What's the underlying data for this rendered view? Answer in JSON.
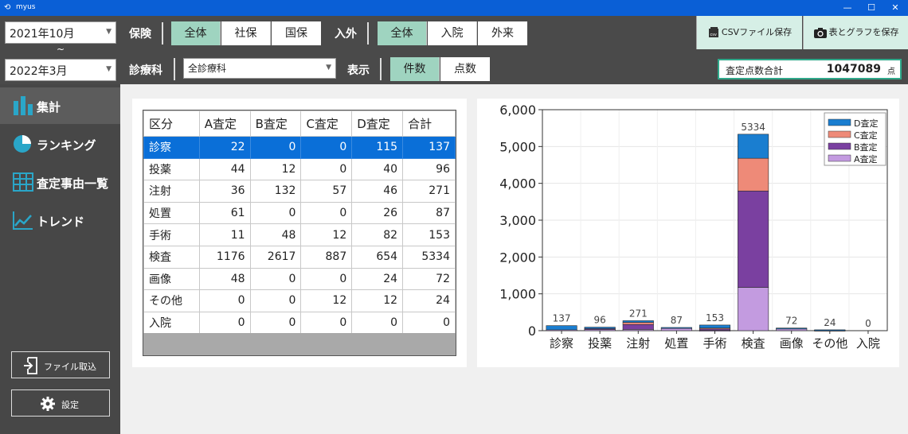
{
  "window": {
    "title": "myus",
    "minimize": "—",
    "maximize": "☐",
    "close": "✕"
  },
  "toolbar": {
    "period_from": "2021年10月",
    "period_tilde": "~",
    "period_to": "2022年3月",
    "insurance_label": "保険",
    "insurance_options": [
      "全体",
      "社保",
      "国保"
    ],
    "inout_label": "入外",
    "inout_options": [
      "全体",
      "入院",
      "外来"
    ],
    "dept_label": "診療科",
    "dept_value": "全診療科",
    "display_label": "表示",
    "display_options": [
      "件数",
      "点数"
    ],
    "csv_button": "CSVファイル保存",
    "save_button": "表とグラフを保存",
    "total_label": "査定点数合計",
    "total_value": "1047089",
    "total_unit": "点"
  },
  "sidebar": {
    "items": [
      {
        "label": "集計",
        "icon": "bar-chart-icon"
      },
      {
        "label": "ランキング",
        "icon": "pie-chart-icon"
      },
      {
        "label": "査定事由一覧",
        "icon": "table-icon"
      },
      {
        "label": "トレンド",
        "icon": "trend-icon"
      }
    ],
    "import_button": "ファイル取込",
    "settings_button": "設定"
  },
  "table": {
    "headers": [
      "区分",
      "A査定",
      "B査定",
      "C査定",
      "D査定",
      "合計"
    ],
    "rows": [
      [
        "診察",
        "22",
        "0",
        "0",
        "115",
        "137"
      ],
      [
        "投薬",
        "44",
        "12",
        "0",
        "40",
        "96"
      ],
      [
        "注射",
        "36",
        "132",
        "57",
        "46",
        "271"
      ],
      [
        "処置",
        "61",
        "0",
        "0",
        "26",
        "87"
      ],
      [
        "手術",
        "11",
        "48",
        "12",
        "82",
        "153"
      ],
      [
        "検査",
        "1176",
        "2617",
        "887",
        "654",
        "5334"
      ],
      [
        "画像",
        "48",
        "0",
        "0",
        "24",
        "72"
      ],
      [
        "その他",
        "0",
        "0",
        "12",
        "12",
        "24"
      ],
      [
        "入院",
        "0",
        "0",
        "0",
        "0",
        "0"
      ]
    ]
  },
  "chart_data": {
    "type": "bar",
    "stacked": true,
    "categories": [
      "診察",
      "投薬",
      "注射",
      "処置",
      "手術",
      "検査",
      "画像",
      "その他",
      "入院"
    ],
    "series": [
      {
        "name": "A査定",
        "values": [
          22,
          44,
          36,
          61,
          11,
          1176,
          48,
          0,
          0
        ],
        "color": "#c39be0"
      },
      {
        "name": "B査定",
        "values": [
          0,
          12,
          132,
          0,
          48,
          2617,
          0,
          0,
          0
        ],
        "color": "#7a40a0"
      },
      {
        "name": "C査定",
        "values": [
          0,
          0,
          57,
          0,
          12,
          887,
          0,
          12,
          0
        ],
        "color": "#ee8a78"
      },
      {
        "name": "D査定",
        "values": [
          115,
          40,
          46,
          26,
          82,
          654,
          24,
          12,
          0
        ],
        "color": "#1a7ed0"
      }
    ],
    "totals": [
      137,
      96,
      271,
      87,
      153,
      5334,
      72,
      24,
      0
    ],
    "ylim": [
      0,
      6000
    ],
    "yticks": [
      "0",
      "1,000",
      "2,000",
      "3,000",
      "4,000",
      "5,000",
      "6,000"
    ],
    "legend_order": [
      "D査定",
      "C査定",
      "B査定",
      "A査定"
    ],
    "legend_placement": "top-right",
    "grid": true
  }
}
